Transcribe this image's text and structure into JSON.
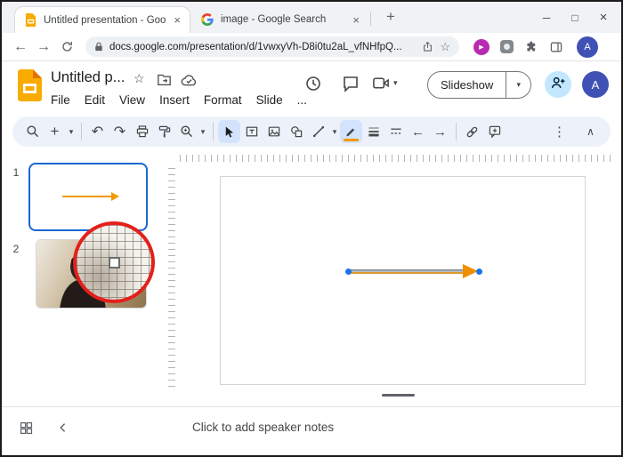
{
  "browser": {
    "tabs": [
      {
        "title": "Untitled presentation - Google S"
      },
      {
        "title": "image - Google Search"
      }
    ],
    "url": "docs.google.com/presentation/d/1vwxyVh-D8i0tu2aL_vfNHfpQ...",
    "profile_letter": "A",
    "glyphs": {
      "close_tab": "×",
      "new_tab": "+",
      "back": "←",
      "forward": "→",
      "star": "☆",
      "minimize": "─",
      "maximize": "□",
      "close_window": "×",
      "play": "▶"
    }
  },
  "app": {
    "title": "Untitled p...",
    "menus": [
      {
        "label": "File"
      },
      {
        "label": "Edit"
      },
      {
        "label": "View"
      },
      {
        "label": "Insert"
      },
      {
        "label": "Format"
      },
      {
        "label": "Slide"
      },
      {
        "label": "..."
      }
    ],
    "slideshow_label": "Slideshow",
    "avatar_letter": "A",
    "glyphs": {
      "star": "☆",
      "caret": "▾"
    }
  },
  "toolbar": {
    "glyphs": {
      "plus": "+",
      "caret": "▾",
      "undo": "↶",
      "redo": "↷",
      "line_start": "←",
      "line_end": "→",
      "more": "⋮",
      "collapse": "∧"
    }
  },
  "filmstrip": {
    "slides": [
      {
        "number": "1"
      },
      {
        "number": "2"
      }
    ]
  },
  "notes": {
    "placeholder": "Click to add speaker notes"
  },
  "colors": {
    "accent_blue": "#1a73e8",
    "selection_blue": "#1967d2",
    "arrow_orange": "#f29900",
    "annotation_red": "#e3201b",
    "toolbar_bg": "#edf2fa",
    "share_button_bg": "#c2e7ff",
    "avatar_bg": "#4051b5"
  }
}
